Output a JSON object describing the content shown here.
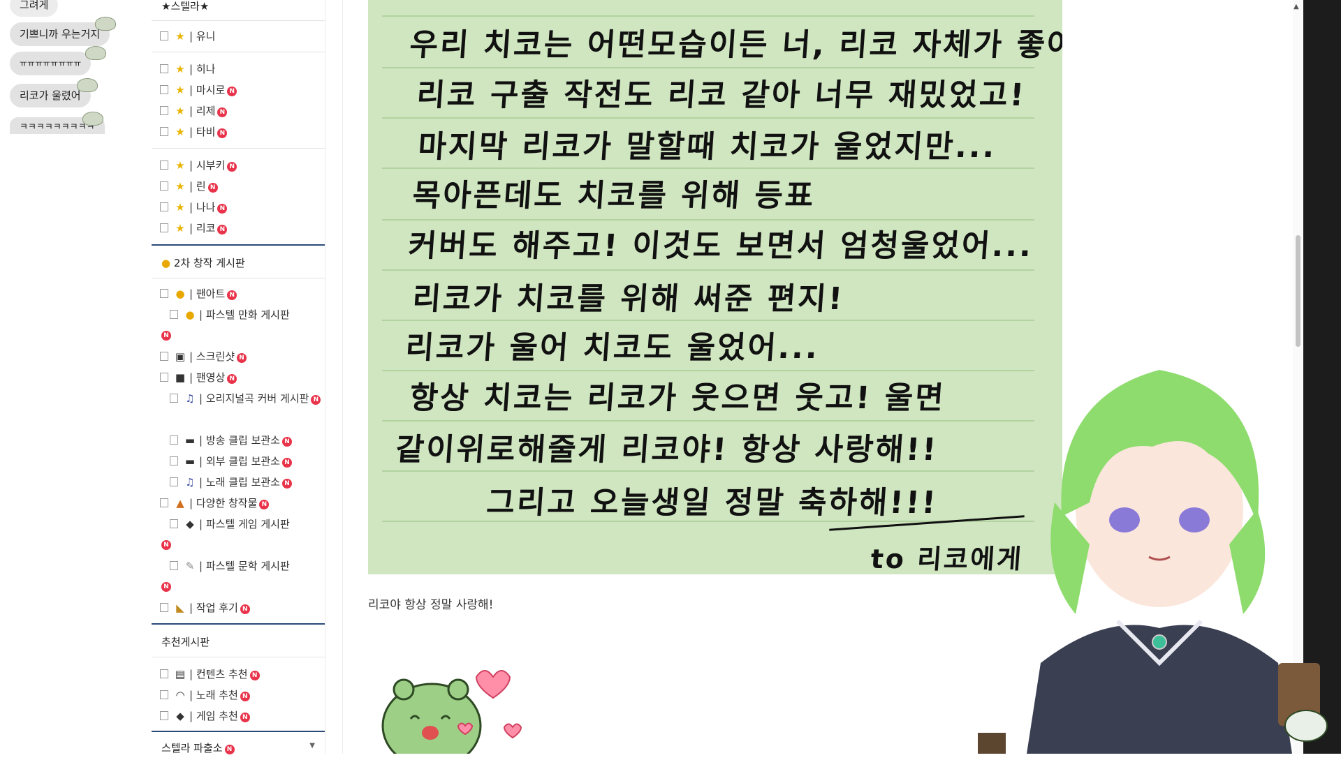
{
  "chat": {
    "bubbles": [
      "그려게",
      "기쁘니까 우는거지",
      "ㅠㅠㅠㅠㅠㅠㅠㅠ",
      "리코가 울렸어",
      "ㅋㅋㅋㅋㅋㅋㅋㅋㅋ"
    ]
  },
  "sidebar": {
    "top_title": "★스텔라★",
    "group1": [
      {
        "label": "유니",
        "new": false
      }
    ],
    "group2": [
      {
        "label": "히나",
        "new": false
      },
      {
        "label": "마시로",
        "new": true
      },
      {
        "label": "리제",
        "new": true
      },
      {
        "label": "타비",
        "new": true
      }
    ],
    "group3": [
      {
        "label": "시부키",
        "new": true
      },
      {
        "label": "린",
        "new": true
      },
      {
        "label": "나나",
        "new": true
      },
      {
        "label": "리코",
        "new": true
      }
    ],
    "fan_section_title": "2차 창작 게시판",
    "fan_items": [
      {
        "label": "팬아트",
        "new": true
      },
      {
        "label": "파스텔 만화 게시판",
        "new": true
      },
      {
        "label": "스크린샷",
        "new": true
      },
      {
        "label": "팬영상",
        "new": true
      },
      {
        "label": "오리지널곡 커버 게시판",
        "new": true
      },
      {
        "label": "방송 클립 보관소",
        "new": true
      },
      {
        "label": "외부 클립 보관소",
        "new": true
      },
      {
        "label": "노래 클립 보관소",
        "new": true
      },
      {
        "label": "다양한 창작물",
        "new": true
      },
      {
        "label": "파스텔 게임 게시판",
        "new": true
      },
      {
        "label": "파스텔 문학 게시판",
        "new": true
      },
      {
        "label": "작업 후기",
        "new": true
      }
    ],
    "rec_section_title": "추천게시판",
    "rec_items": [
      {
        "label": "컨텐츠 추천",
        "new": true
      },
      {
        "label": "노래 추천",
        "new": true
      },
      {
        "label": "게임 추천",
        "new": true
      }
    ],
    "bottom_section_title": "스텔라 파출소",
    "separator": "|",
    "new_badge": "N"
  },
  "letter": {
    "lines": [
      "우리 치코는 어떤모습이든 너, 리코 자체가 좋아!",
      "리코 구출 작전도 리코 같아 너무 재밌었고!",
      "마지막 리코가 말할때 치코가 울었지만...",
      "목아픈데도 치코를 위해 등표",
      "커버도 해주고! 이것도 보면서 엄청울었어...",
      "리코가 치코를 위해 써준 편지!",
      "리코가 울어 치코도 울었어...",
      "항상 치코는 리코가 웃으면 웃고! 울면",
      "같이위로해줄게 리코야! 항상 사랑해!!",
      "그리고 오늘생일 정말 축하해!!!",
      "to 리코에게"
    ]
  },
  "post": {
    "caption": "리코야 항상 정말 사랑해!"
  },
  "colors": {
    "letter_bg": "#cfe6c0",
    "accent_rule": "#2a4a7a",
    "new_badge": "#e8334a",
    "star": "#e8b400"
  }
}
